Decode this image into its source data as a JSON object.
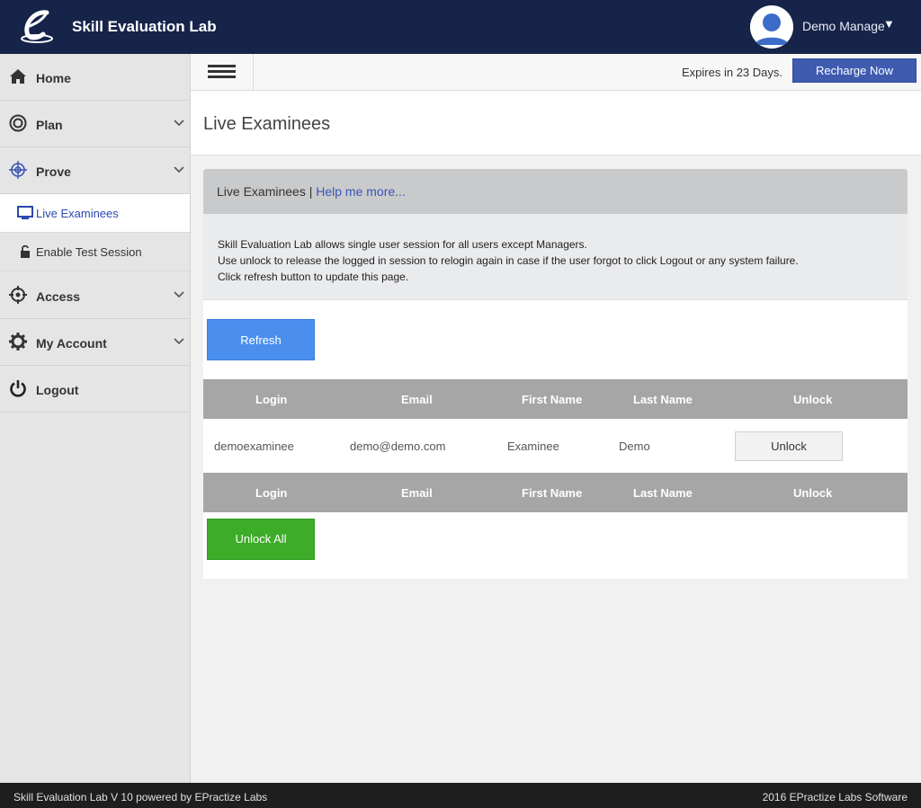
{
  "app": {
    "brand": "Skill Evaluation Lab"
  },
  "user": {
    "name": "Demo Manage",
    "caret": "▼"
  },
  "sidebar": {
    "items": [
      {
        "label": "Home",
        "icon": "home-icon"
      },
      {
        "label": "Plan",
        "icon": "target-circle-icon"
      },
      {
        "label": "Prove",
        "icon": "crosshair-icon"
      },
      {
        "label": "Access",
        "icon": "access-icon"
      },
      {
        "label": "My Account",
        "icon": "gear-icon"
      },
      {
        "label": "Logout",
        "icon": "power-icon"
      }
    ],
    "subitems": [
      {
        "label": "Live Examinees",
        "icon": "monitor-icon"
      },
      {
        "label": "Enable Test Session",
        "icon": "lock-icon"
      }
    ]
  },
  "toolbar": {
    "expires": "Expires in 23 Days.",
    "recharge": "Recharge Now"
  },
  "page": {
    "title": "Live Examinees"
  },
  "panel": {
    "heading": "Live Examinees",
    "separator": "|",
    "help_link": "Help me more...",
    "info": [
      "Skill Evaluation Lab allows single user session for all users except Managers.",
      "Use unlock to release the logged in session to relogin again in case if the user forgot to click Logout or any system failure.",
      "Click refresh button to update this page."
    ],
    "refresh": "Refresh",
    "unlock_all": "Unlock All"
  },
  "table": {
    "headers": [
      "Login",
      "Email",
      "First Name",
      "Last Name",
      "Unlock"
    ],
    "rows": [
      {
        "login": "demoexaminee",
        "email": "demo@demo.com",
        "first": "Examinee",
        "last": "Demo",
        "action": "Unlock"
      }
    ]
  },
  "footer": {
    "left": "Skill Evaluation Lab V 10 powered by EPractize Labs",
    "right": "2016 EPractize Labs Software"
  },
  "colors": {
    "header": "#16244a",
    "accent": "#3e5bb0",
    "refresh": "#4a8fee",
    "unlock_all": "#3dac29"
  }
}
